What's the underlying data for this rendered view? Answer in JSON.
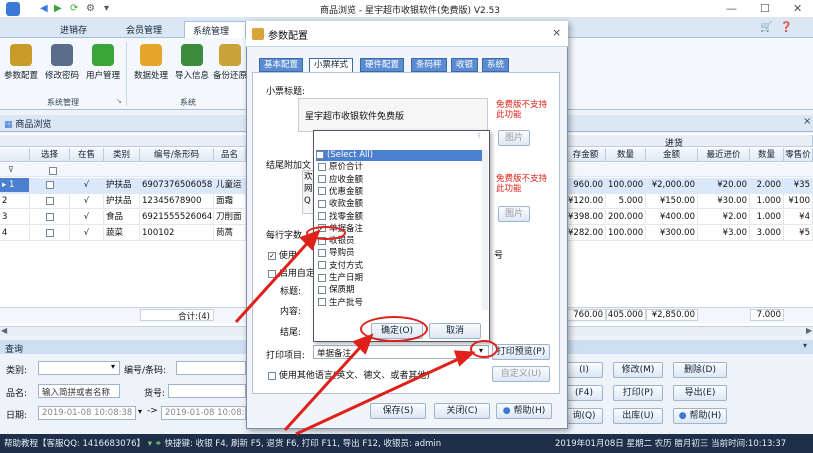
{
  "window": {
    "title": "商品浏览 - 星宇超市收银软件(免费版) V2.53",
    "min": "—",
    "max": "☐",
    "close": "✕"
  },
  "ribbon": {
    "tabs": [
      "进销存",
      "会员管理",
      "系统管理"
    ],
    "buttons": [
      "参数配置",
      "修改密码",
      "用户管理",
      "数据处理",
      "导入信息",
      "备份还原"
    ],
    "groups": [
      "系统管理",
      "系统"
    ]
  },
  "doc": {
    "tab": "商品浏览"
  },
  "grid": {
    "group_headers": {
      "goods": "商品",
      "purchase": "进货"
    },
    "columns": [
      "选择",
      "在售",
      "类别",
      "编号/条形码",
      "品名",
      "存金额",
      "数量",
      "金额",
      "最近进价",
      "数量",
      "零售价"
    ],
    "rows": [
      {
        "no": "1",
        "onsale": "√",
        "cat": "护扶品",
        "code": "6907376506058",
        "name": "儿童运",
        "stock_amt": "960.00",
        "qty": "100.000",
        "amount": "¥2,000.00",
        "last_price": "¥20.00",
        "qty2": "2.000",
        "retail": "¥35"
      },
      {
        "no": "2",
        "onsale": "√",
        "cat": "护扶品",
        "code": "12345678900",
        "name": "面霜",
        "stock_amt": "¥120.00",
        "qty": "5.000",
        "amount": "¥150.00",
        "last_price": "¥30.00",
        "qty2": "1.000",
        "retail": "¥100"
      },
      {
        "no": "3",
        "onsale": "√",
        "cat": "食品",
        "code": "6921555526064",
        "name": "刀削面",
        "stock_amt": "¥398.00",
        "qty": "200.000",
        "amount": "¥400.00",
        "last_price": "¥2.00",
        "qty2": "1.000",
        "retail": "¥4"
      },
      {
        "no": "4",
        "onsale": "√",
        "cat": "蔬菜",
        "code": "100102",
        "name": "茼蒿",
        "stock_amt": "¥282.00",
        "qty": "100.000",
        "amount": "¥300.00",
        "last_price": "¥3.00",
        "qty2": "3.000",
        "retail": "¥5"
      }
    ],
    "totals": {
      "label": "合计:(4)",
      "stock_amt": "760.00",
      "qty": "405.000",
      "amount": "¥2,850.00",
      "qty2": "7.000"
    }
  },
  "query": {
    "header": "查询",
    "category_label": "类别:",
    "code_label": "编号/条码:",
    "name_label": "品名:",
    "name_value": "输入简拼或者名称",
    "shelf_label": "货号:",
    "date_label": "日期:",
    "date_from": "2019-01-08 10:08:38",
    "date_to": "2019-01-08 10:08:38",
    "buttons": [
      "(I)",
      "修改(M)",
      "删除(D)",
      "(F4)",
      "打印(P)",
      "导出(E)",
      "询(Q)",
      "出库(U)",
      "帮助(H)"
    ]
  },
  "status": {
    "left": "帮助教程【客服QQ: 1416683076】",
    "hints": "快捷键: 收银 F4, 刷新 F5, 退货 F6, 打印 F11, 导出 F12",
    "cashier": "收银员: admin",
    "datetime": "2019年01月08日 星期二 农历 腊月初三 当前时间:10:13:37"
  },
  "dialog": {
    "title": "参数配置",
    "close": "×",
    "tabs": [
      "基本配置",
      "小票样式",
      "硬件配置",
      "条码秤",
      "收银",
      "系统"
    ],
    "receipt_title_label": "小票标题:",
    "receipt_title_value": "星宇超市收银软件免费版",
    "free_note1": "免费版不支持此功能",
    "free_note2": "免费版不支持此功能",
    "image_btn1": "图片",
    "image_btn2": "图片",
    "footer_label": "结尾附加文",
    "footer_lines": [
      "欢",
      "网",
      "Q"
    ],
    "line_chars_label": "每行字数",
    "use_label": "使用",
    "use_custom": "启用自定",
    "title_label": "标题:",
    "content_label": "内容:",
    "ending_label": "结尾:",
    "hao": "号",
    "print_item_label": "打印项目:",
    "print_item_value": "单据备注",
    "print_preview_btn": "打印预览(P)",
    "custom_btn": "自定义(U)",
    "other_lang": "使用其他语言(英文、德文、或者其他)",
    "save_btn": "保存(S)",
    "close_btn": "关闭(C)",
    "help_btn": "帮助(H)"
  },
  "dropdown": {
    "items": [
      {
        "label": "(Select All)",
        "checked": false,
        "selected": true
      },
      {
        "label": "原价合计",
        "checked": false
      },
      {
        "label": "应收金额",
        "checked": false
      },
      {
        "label": "优惠金额",
        "checked": false
      },
      {
        "label": "收款金额",
        "checked": false
      },
      {
        "label": "找零金额",
        "checked": false
      },
      {
        "label": "单据备注",
        "checked": true
      },
      {
        "label": "收银员",
        "checked": false
      },
      {
        "label": "导购员",
        "checked": false
      },
      {
        "label": "支付方式",
        "checked": false
      },
      {
        "label": "生产日期",
        "checked": false
      },
      {
        "label": "保质期",
        "checked": false
      },
      {
        "label": "生产批号",
        "checked": false
      }
    ],
    "ok": "确定(O)",
    "cancel": "取消"
  },
  "colors": {
    "annotation": "#e0201a",
    "selected_row": "#4b7fd0",
    "header_blue": "#5b8bd0"
  }
}
